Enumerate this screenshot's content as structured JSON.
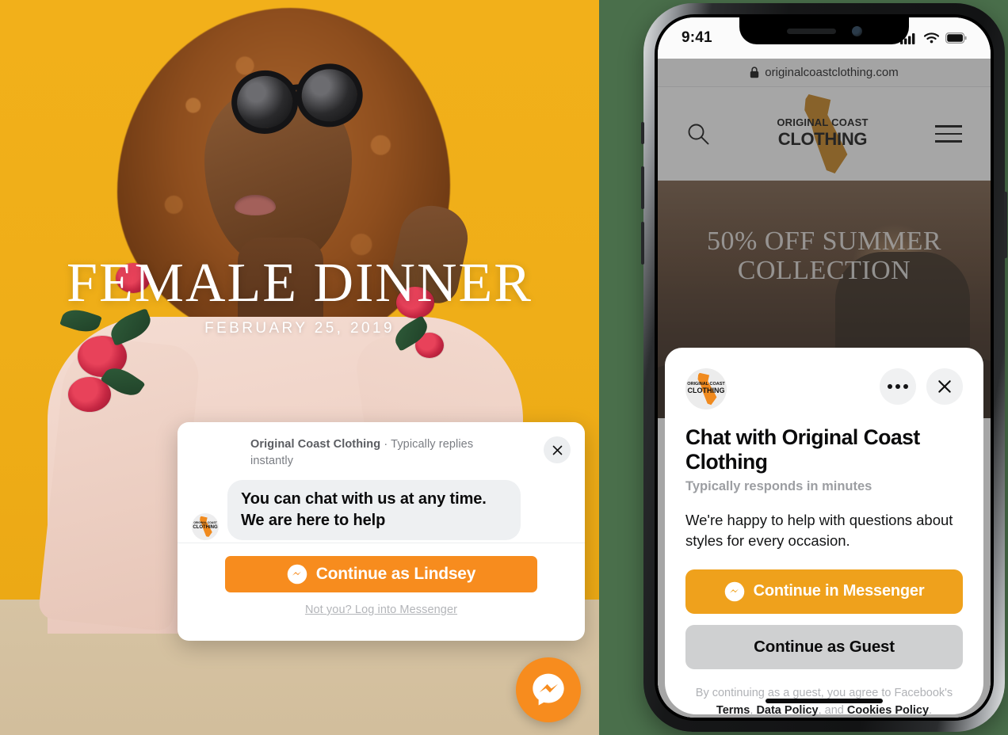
{
  "left_panel": {
    "hero": {
      "title": "FEMALE DINNER",
      "date": "FEBRUARY 25, 2019"
    },
    "chat_card": {
      "business_name": "Original Coast Clothing",
      "separator": " · ",
      "status": "Typically replies instantly",
      "message": "You can chat with us at any time. We are here to help",
      "primary_button": "Continue as Lindsey",
      "secondary_link": "Not you? Log into Messenger",
      "close_icon": "close-icon",
      "avatar_icon": "business-avatar",
      "messenger_icon": "messenger-logo-icon"
    },
    "fab": {
      "icon": "messenger-logo-icon",
      "label": "Open Messenger chat"
    }
  },
  "phone": {
    "status_bar": {
      "time": "9:41",
      "cellular_icon": "signal-bars-icon",
      "wifi_icon": "wifi-icon",
      "battery_icon": "battery-icon"
    },
    "browser": {
      "lock_icon": "lock-icon",
      "url": "originalcoastclothing.com"
    },
    "site": {
      "search_icon": "search-icon",
      "menu_icon": "hamburger-menu-icon",
      "logo_line1": "ORIGINAL COAST",
      "logo_line2": "CLOTHING",
      "hero_caption": "50% OFF SUMMER COLLECTION"
    },
    "sheet": {
      "avatar_icon": "business-avatar",
      "more_icon": "more-options-icon",
      "close_icon": "close-icon",
      "title": "Chat with Original Coast Clothing",
      "subtitle": "Typically responds in minutes",
      "body": "We're happy to help with questions about styles for every occasion.",
      "primary_button": "Continue in Messenger",
      "secondary_button": "Continue as Guest",
      "messenger_icon": "messenger-logo-icon",
      "legal": {
        "prefix": "By continuing as a guest, you agree to Facebook's ",
        "terms": "Terms",
        "comma1": ", ",
        "data_policy": "Data Policy",
        "conjunction": ", and ",
        "cookies_policy": "Cookies Policy",
        "period": "."
      }
    }
  },
  "colors": {
    "messenger_orange": "#F78C1E",
    "amber_button": "#EFA11C",
    "grey_button": "#CFD0D1",
    "green_backdrop": "#4A6F4B",
    "wall_yellow": "#F0B01C",
    "floor_beige": "#D4C1A0",
    "logo_brown": "#C8821A"
  }
}
